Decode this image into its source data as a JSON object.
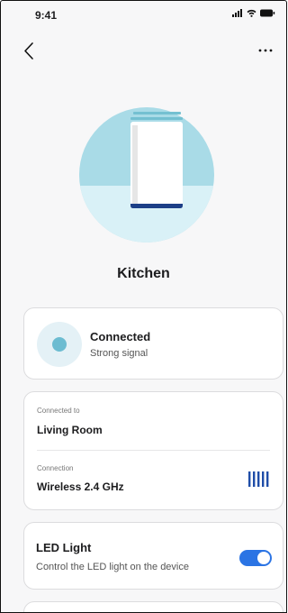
{
  "status_bar": {
    "time": "9:41"
  },
  "device": {
    "name": "Kitchen"
  },
  "connection_status": {
    "title": "Connected",
    "subtitle": "Strong signal"
  },
  "connection_info": {
    "connected_to_label": "Connected to",
    "connected_to_value": "Living Room",
    "connection_label": "Connection",
    "connection_value": "Wireless 2.4 GHz"
  },
  "led": {
    "title": "LED Light",
    "subtitle": "Control the LED light on the device",
    "enabled": true
  },
  "colors": {
    "accent": "#2b74e4",
    "signal": "#6cbcd1",
    "hero_bg": "#a9dbe7"
  }
}
